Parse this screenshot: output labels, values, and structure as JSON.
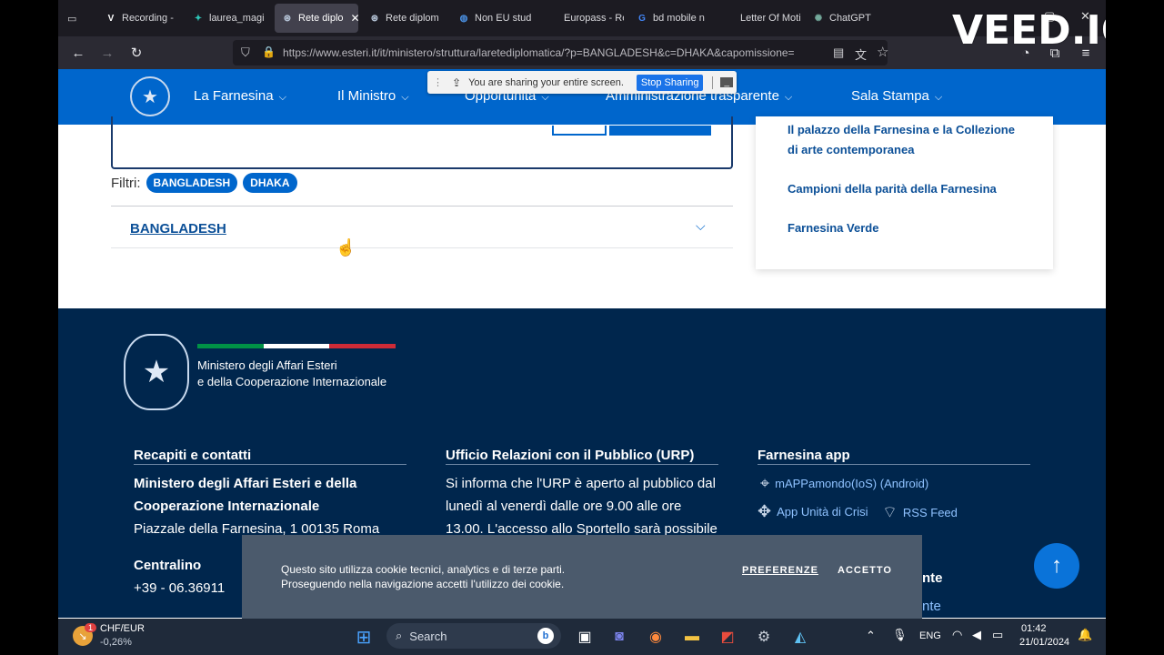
{
  "tabs": [
    {
      "label": "Recording -",
      "fav": "V",
      "favcolor": "#ffffff",
      "icon": "veed-icon"
    },
    {
      "label": "laurea_magi",
      "fav": "✦",
      "favcolor": "#2ec4b6",
      "icon": "sparkle-icon"
    },
    {
      "label": "Rete diplo",
      "fav": "⊛",
      "favcolor": "#b7c6d9",
      "icon": "emblem-icon",
      "active": true
    },
    {
      "label": "Rete diplom",
      "fav": "⊛",
      "favcolor": "#b7c6d9",
      "icon": "emblem-icon"
    },
    {
      "label": "Non EU stud",
      "fav": "◍",
      "favcolor": "#4a90e2",
      "icon": "globe-icon"
    },
    {
      "label": "Europass - Resu",
      "fav": "",
      "favcolor": "#ffffff",
      "icon": "europass-icon"
    },
    {
      "label": "bd mobile n",
      "fav": "G",
      "favcolor": "#4285f4",
      "icon": "google-icon"
    },
    {
      "label": "Letter Of Motiva",
      "fav": "",
      "favcolor": "#ffffff",
      "icon": "doc-icon"
    },
    {
      "label": "ChatGPT",
      "fav": "✺",
      "favcolor": "#74aa9c",
      "icon": "chatgpt-icon"
    }
  ],
  "url": "https://www.esteri.it/it/ministero/struttura/laretediplomatica/?p=BANGLADESH&c=DHAKA&capomissione=",
  "watermark": "VEED.IO",
  "sharing": {
    "message": "You are sharing your entire screen.",
    "stop": "Stop Sharing"
  },
  "menu": [
    "La Farnesina",
    "Il Ministro",
    "Opportunità",
    "Amministrazione trasparente",
    "Sala Stampa"
  ],
  "filters": {
    "label": "Filtri:",
    "chips": [
      "BANGLADESH",
      "DHAKA"
    ]
  },
  "accordion": {
    "title": "BANGLADESH"
  },
  "sidebar": {
    "links": [
      "Il palazzo della Farnesina e la Collezione di arte contemporanea",
      "Campioni della parità della Farnesina",
      "Farnesina Verde"
    ]
  },
  "footer": {
    "ministry_line1": "Ministero degli Affari Esteri",
    "ministry_line2": "e della Cooperazione Internazionale",
    "flag_colors": [
      "#009246",
      "#ffffff",
      "#ce2b37"
    ],
    "col1": {
      "title": "Recapiti e contatti",
      "org_line1": "Ministero degli Affari Esteri e della",
      "org_line2": "Cooperazione Internazionale",
      "address": "Piazzale della Farnesina, 1 00135 Roma",
      "phone_label": "Centralino",
      "phone": "+39 - 06.36911"
    },
    "col2": {
      "title": "Ufficio Relazioni con il Pubblico (URP)",
      "line1": "Si informa che l'URP è aperto al pubblico dal",
      "line2": "lunedì al venerdì dalle ore 9.00 alle ore",
      "line3": "13.00. L'accesso allo Sportello sarà possibile"
    },
    "col3": {
      "title": "Farnesina app",
      "app1": "mAPPamondo(IoS) (Android)",
      "app2": "App Unità di Crisi",
      "app3": "RSS Feed",
      "partial_title": "nte",
      "partial_link": "nte"
    }
  },
  "cookie": {
    "line1": "Questo sito utilizza cookie tecnici, analytics e di terze parti.",
    "line2": "Proseguendo nella navigazione accetti l'utilizzo dei cookie.",
    "preferences": "PREFERENZE",
    "accept": "ACCETTO"
  },
  "taskbar": {
    "ticker_name": "CHF/EUR",
    "ticker_change": "-0,26%",
    "ticker_badge": "1",
    "search": "Search",
    "lang": "ENG",
    "time": "01:42",
    "date": "21/01/2024"
  }
}
